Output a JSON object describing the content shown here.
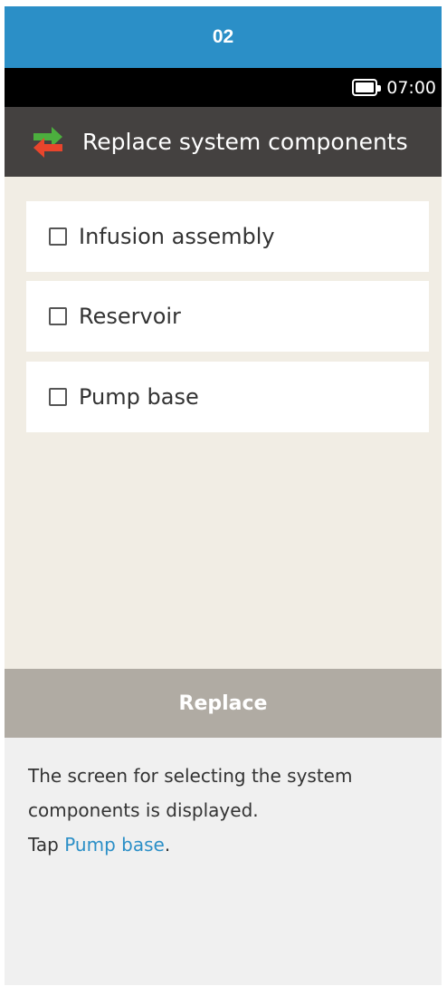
{
  "step": {
    "number": "02"
  },
  "status_bar": {
    "battery_icon": "battery-icon",
    "time": "07:00"
  },
  "title_bar": {
    "icon": "swap-arrows-icon",
    "title": "Replace system components"
  },
  "components": [
    {
      "label": "Infusion assembly",
      "checked": false
    },
    {
      "label": "Reservoir",
      "checked": false
    },
    {
      "label": "Pump base",
      "checked": false
    }
  ],
  "replace_button": {
    "label": "Replace"
  },
  "instructions": {
    "line1": "The screen for selecting the system components is displayed.",
    "line2_prefix": "Tap ",
    "line2_link": "Pump base",
    "line2_suffix": "."
  },
  "colors": {
    "step_header": "#2b8fc7",
    "title_bar": "#444140",
    "content_bg": "#f1ede4",
    "replace_button": "#b0aba3",
    "link": "#2b8fc7",
    "arrow_green": "#4caf3e",
    "arrow_red": "#e8452c"
  }
}
